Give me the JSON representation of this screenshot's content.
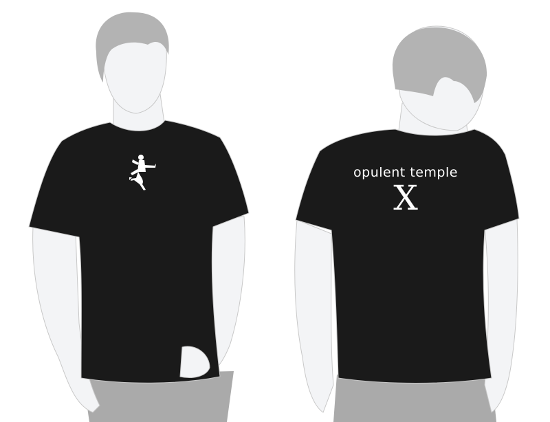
{
  "front": {
    "logo": "dancing-shiva-logo"
  },
  "back": {
    "brand_text": "opulent temple",
    "numeral": "X"
  },
  "colors": {
    "shirt": "#1a1a1a",
    "skin": "#f3f4f6",
    "hair": "#b3b3b3",
    "pants": "#aaaaaa",
    "print": "#ffffff"
  }
}
